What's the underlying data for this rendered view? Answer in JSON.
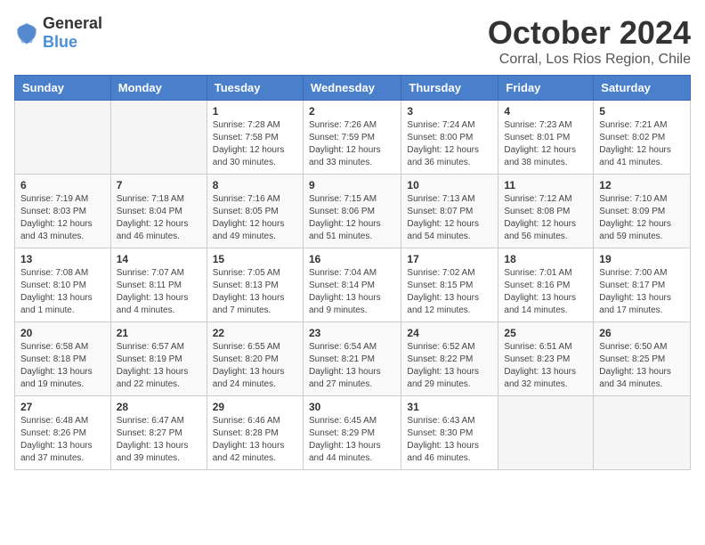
{
  "logo": {
    "general": "General",
    "blue": "Blue"
  },
  "header": {
    "month": "October 2024",
    "location": "Corral, Los Rios Region, Chile"
  },
  "weekdays": [
    "Sunday",
    "Monday",
    "Tuesday",
    "Wednesday",
    "Thursday",
    "Friday",
    "Saturday"
  ],
  "weeks": [
    [
      {
        "day": "",
        "sunrise": "",
        "sunset": "",
        "daylight": ""
      },
      {
        "day": "",
        "sunrise": "",
        "sunset": "",
        "daylight": ""
      },
      {
        "day": "1",
        "sunrise": "Sunrise: 7:28 AM",
        "sunset": "Sunset: 7:58 PM",
        "daylight": "Daylight: 12 hours and 30 minutes."
      },
      {
        "day": "2",
        "sunrise": "Sunrise: 7:26 AM",
        "sunset": "Sunset: 7:59 PM",
        "daylight": "Daylight: 12 hours and 33 minutes."
      },
      {
        "day": "3",
        "sunrise": "Sunrise: 7:24 AM",
        "sunset": "Sunset: 8:00 PM",
        "daylight": "Daylight: 12 hours and 36 minutes."
      },
      {
        "day": "4",
        "sunrise": "Sunrise: 7:23 AM",
        "sunset": "Sunset: 8:01 PM",
        "daylight": "Daylight: 12 hours and 38 minutes."
      },
      {
        "day": "5",
        "sunrise": "Sunrise: 7:21 AM",
        "sunset": "Sunset: 8:02 PM",
        "daylight": "Daylight: 12 hours and 41 minutes."
      }
    ],
    [
      {
        "day": "6",
        "sunrise": "Sunrise: 7:19 AM",
        "sunset": "Sunset: 8:03 PM",
        "daylight": "Daylight: 12 hours and 43 minutes."
      },
      {
        "day": "7",
        "sunrise": "Sunrise: 7:18 AM",
        "sunset": "Sunset: 8:04 PM",
        "daylight": "Daylight: 12 hours and 46 minutes."
      },
      {
        "day": "8",
        "sunrise": "Sunrise: 7:16 AM",
        "sunset": "Sunset: 8:05 PM",
        "daylight": "Daylight: 12 hours and 49 minutes."
      },
      {
        "day": "9",
        "sunrise": "Sunrise: 7:15 AM",
        "sunset": "Sunset: 8:06 PM",
        "daylight": "Daylight: 12 hours and 51 minutes."
      },
      {
        "day": "10",
        "sunrise": "Sunrise: 7:13 AM",
        "sunset": "Sunset: 8:07 PM",
        "daylight": "Daylight: 12 hours and 54 minutes."
      },
      {
        "day": "11",
        "sunrise": "Sunrise: 7:12 AM",
        "sunset": "Sunset: 8:08 PM",
        "daylight": "Daylight: 12 hours and 56 minutes."
      },
      {
        "day": "12",
        "sunrise": "Sunrise: 7:10 AM",
        "sunset": "Sunset: 8:09 PM",
        "daylight": "Daylight: 12 hours and 59 minutes."
      }
    ],
    [
      {
        "day": "13",
        "sunrise": "Sunrise: 7:08 AM",
        "sunset": "Sunset: 8:10 PM",
        "daylight": "Daylight: 13 hours and 1 minute."
      },
      {
        "day": "14",
        "sunrise": "Sunrise: 7:07 AM",
        "sunset": "Sunset: 8:11 PM",
        "daylight": "Daylight: 13 hours and 4 minutes."
      },
      {
        "day": "15",
        "sunrise": "Sunrise: 7:05 AM",
        "sunset": "Sunset: 8:13 PM",
        "daylight": "Daylight: 13 hours and 7 minutes."
      },
      {
        "day": "16",
        "sunrise": "Sunrise: 7:04 AM",
        "sunset": "Sunset: 8:14 PM",
        "daylight": "Daylight: 13 hours and 9 minutes."
      },
      {
        "day": "17",
        "sunrise": "Sunrise: 7:02 AM",
        "sunset": "Sunset: 8:15 PM",
        "daylight": "Daylight: 13 hours and 12 minutes."
      },
      {
        "day": "18",
        "sunrise": "Sunrise: 7:01 AM",
        "sunset": "Sunset: 8:16 PM",
        "daylight": "Daylight: 13 hours and 14 minutes."
      },
      {
        "day": "19",
        "sunrise": "Sunrise: 7:00 AM",
        "sunset": "Sunset: 8:17 PM",
        "daylight": "Daylight: 13 hours and 17 minutes."
      }
    ],
    [
      {
        "day": "20",
        "sunrise": "Sunrise: 6:58 AM",
        "sunset": "Sunset: 8:18 PM",
        "daylight": "Daylight: 13 hours and 19 minutes."
      },
      {
        "day": "21",
        "sunrise": "Sunrise: 6:57 AM",
        "sunset": "Sunset: 8:19 PM",
        "daylight": "Daylight: 13 hours and 22 minutes."
      },
      {
        "day": "22",
        "sunrise": "Sunrise: 6:55 AM",
        "sunset": "Sunset: 8:20 PM",
        "daylight": "Daylight: 13 hours and 24 minutes."
      },
      {
        "day": "23",
        "sunrise": "Sunrise: 6:54 AM",
        "sunset": "Sunset: 8:21 PM",
        "daylight": "Daylight: 13 hours and 27 minutes."
      },
      {
        "day": "24",
        "sunrise": "Sunrise: 6:52 AM",
        "sunset": "Sunset: 8:22 PM",
        "daylight": "Daylight: 13 hours and 29 minutes."
      },
      {
        "day": "25",
        "sunrise": "Sunrise: 6:51 AM",
        "sunset": "Sunset: 8:23 PM",
        "daylight": "Daylight: 13 hours and 32 minutes."
      },
      {
        "day": "26",
        "sunrise": "Sunrise: 6:50 AM",
        "sunset": "Sunset: 8:25 PM",
        "daylight": "Daylight: 13 hours and 34 minutes."
      }
    ],
    [
      {
        "day": "27",
        "sunrise": "Sunrise: 6:48 AM",
        "sunset": "Sunset: 8:26 PM",
        "daylight": "Daylight: 13 hours and 37 minutes."
      },
      {
        "day": "28",
        "sunrise": "Sunrise: 6:47 AM",
        "sunset": "Sunset: 8:27 PM",
        "daylight": "Daylight: 13 hours and 39 minutes."
      },
      {
        "day": "29",
        "sunrise": "Sunrise: 6:46 AM",
        "sunset": "Sunset: 8:28 PM",
        "daylight": "Daylight: 13 hours and 42 minutes."
      },
      {
        "day": "30",
        "sunrise": "Sunrise: 6:45 AM",
        "sunset": "Sunset: 8:29 PM",
        "daylight": "Daylight: 13 hours and 44 minutes."
      },
      {
        "day": "31",
        "sunrise": "Sunrise: 6:43 AM",
        "sunset": "Sunset: 8:30 PM",
        "daylight": "Daylight: 13 hours and 46 minutes."
      },
      {
        "day": "",
        "sunrise": "",
        "sunset": "",
        "daylight": ""
      },
      {
        "day": "",
        "sunrise": "",
        "sunset": "",
        "daylight": ""
      }
    ]
  ]
}
